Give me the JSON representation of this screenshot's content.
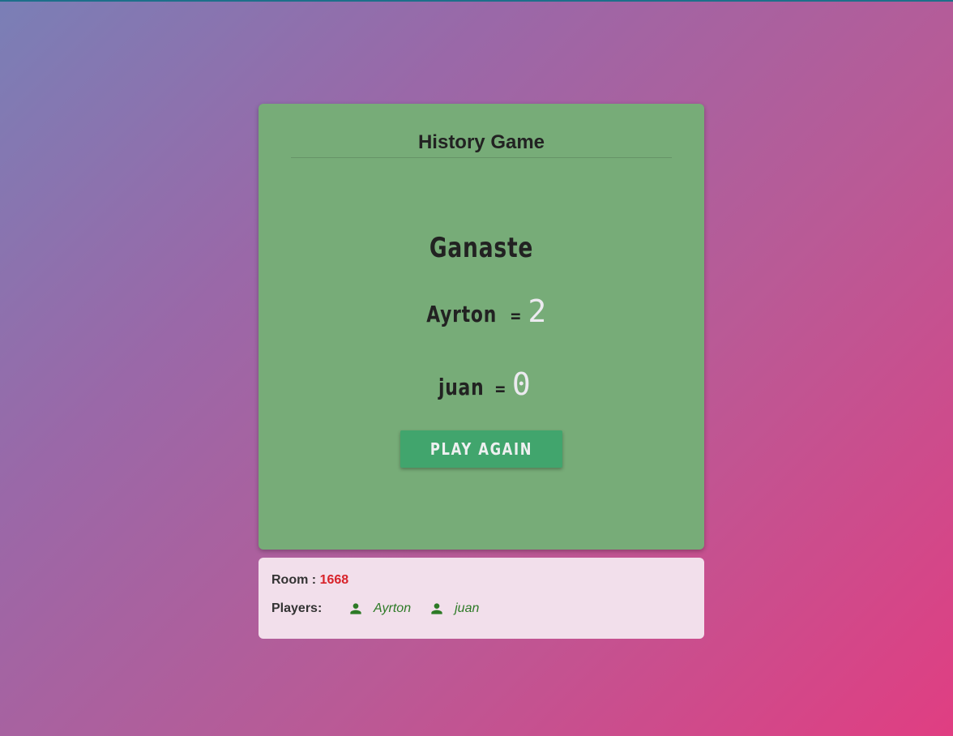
{
  "game": {
    "title": "History Game",
    "result": "Ganaste",
    "scores": [
      {
        "name": "Ayrton",
        "separator": "=",
        "value": "2"
      },
      {
        "name": "juan",
        "separator": "=",
        "value": "0"
      }
    ],
    "play_again_label": "PLAY AGAIN"
  },
  "room": {
    "label": "Room :",
    "number": "1668"
  },
  "players": {
    "label": "Players:",
    "list": [
      {
        "name": "Ayrton",
        "icon": "person-icon"
      },
      {
        "name": "juan",
        "icon": "person-icon"
      }
    ]
  },
  "colors": {
    "card": "#77ac78",
    "button": "#41a56d",
    "room_number": "#d8232a",
    "player_name": "#2d7a26",
    "info_card": "#f2dfeb"
  }
}
